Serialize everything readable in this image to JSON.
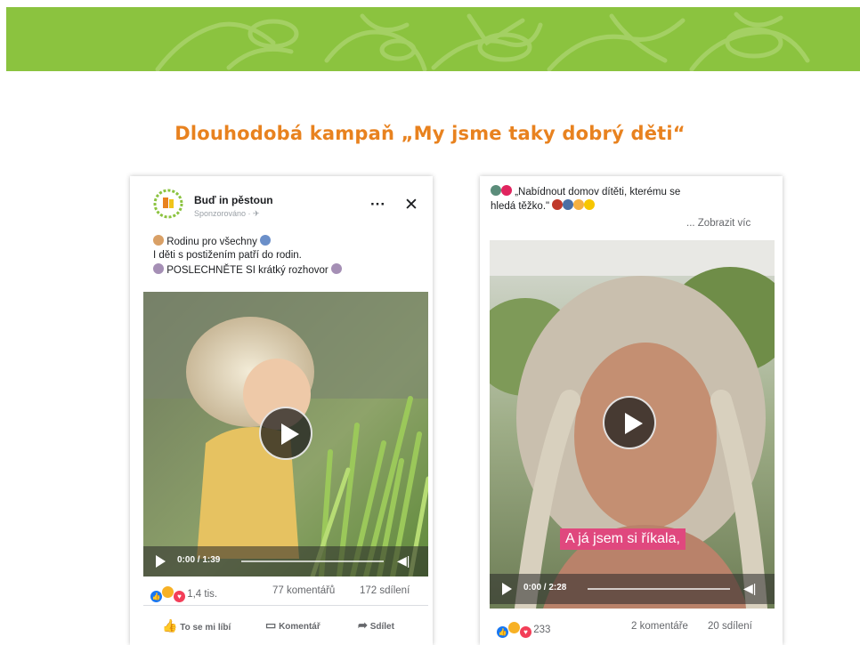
{
  "slide_title": "Dlouhodobá kampaň „My jsme taky dobrý děti“",
  "post1": {
    "page_name": "Buď in pěstoun",
    "sponsored": "Sponzorováno · ✈",
    "more": "···",
    "close": "✕",
    "line1": "Rodinu pro všechny",
    "line2": "I děti s postižením patří do rodin.",
    "line3": "POSLECHNĚTE SI krátký rozhovor",
    "video_time": "0:00 / 1:39",
    "reaction_count": "1,4 tis.",
    "comments": "77 komentářů",
    "shares": "172 sdílení",
    "like_label": "To se mi líbí",
    "comment_label": "Komentář",
    "share_label": "Sdílet"
  },
  "post2": {
    "text_line1": "„Nabídnout domov dítěti, kterému se",
    "text_line2": "hledá těžko.\"",
    "see_more": "... Zobrazit víc",
    "subtitle": "A já jsem si říkala,",
    "video_time": "0:00 / 2:28",
    "reaction_count": "233",
    "comments": "2 komentáře",
    "shares": "20 sdílení"
  },
  "colors": {
    "banner": "#8bc33f",
    "title": "#e8821f",
    "caption": "#e0487e",
    "like_blue": "#1877f2"
  }
}
